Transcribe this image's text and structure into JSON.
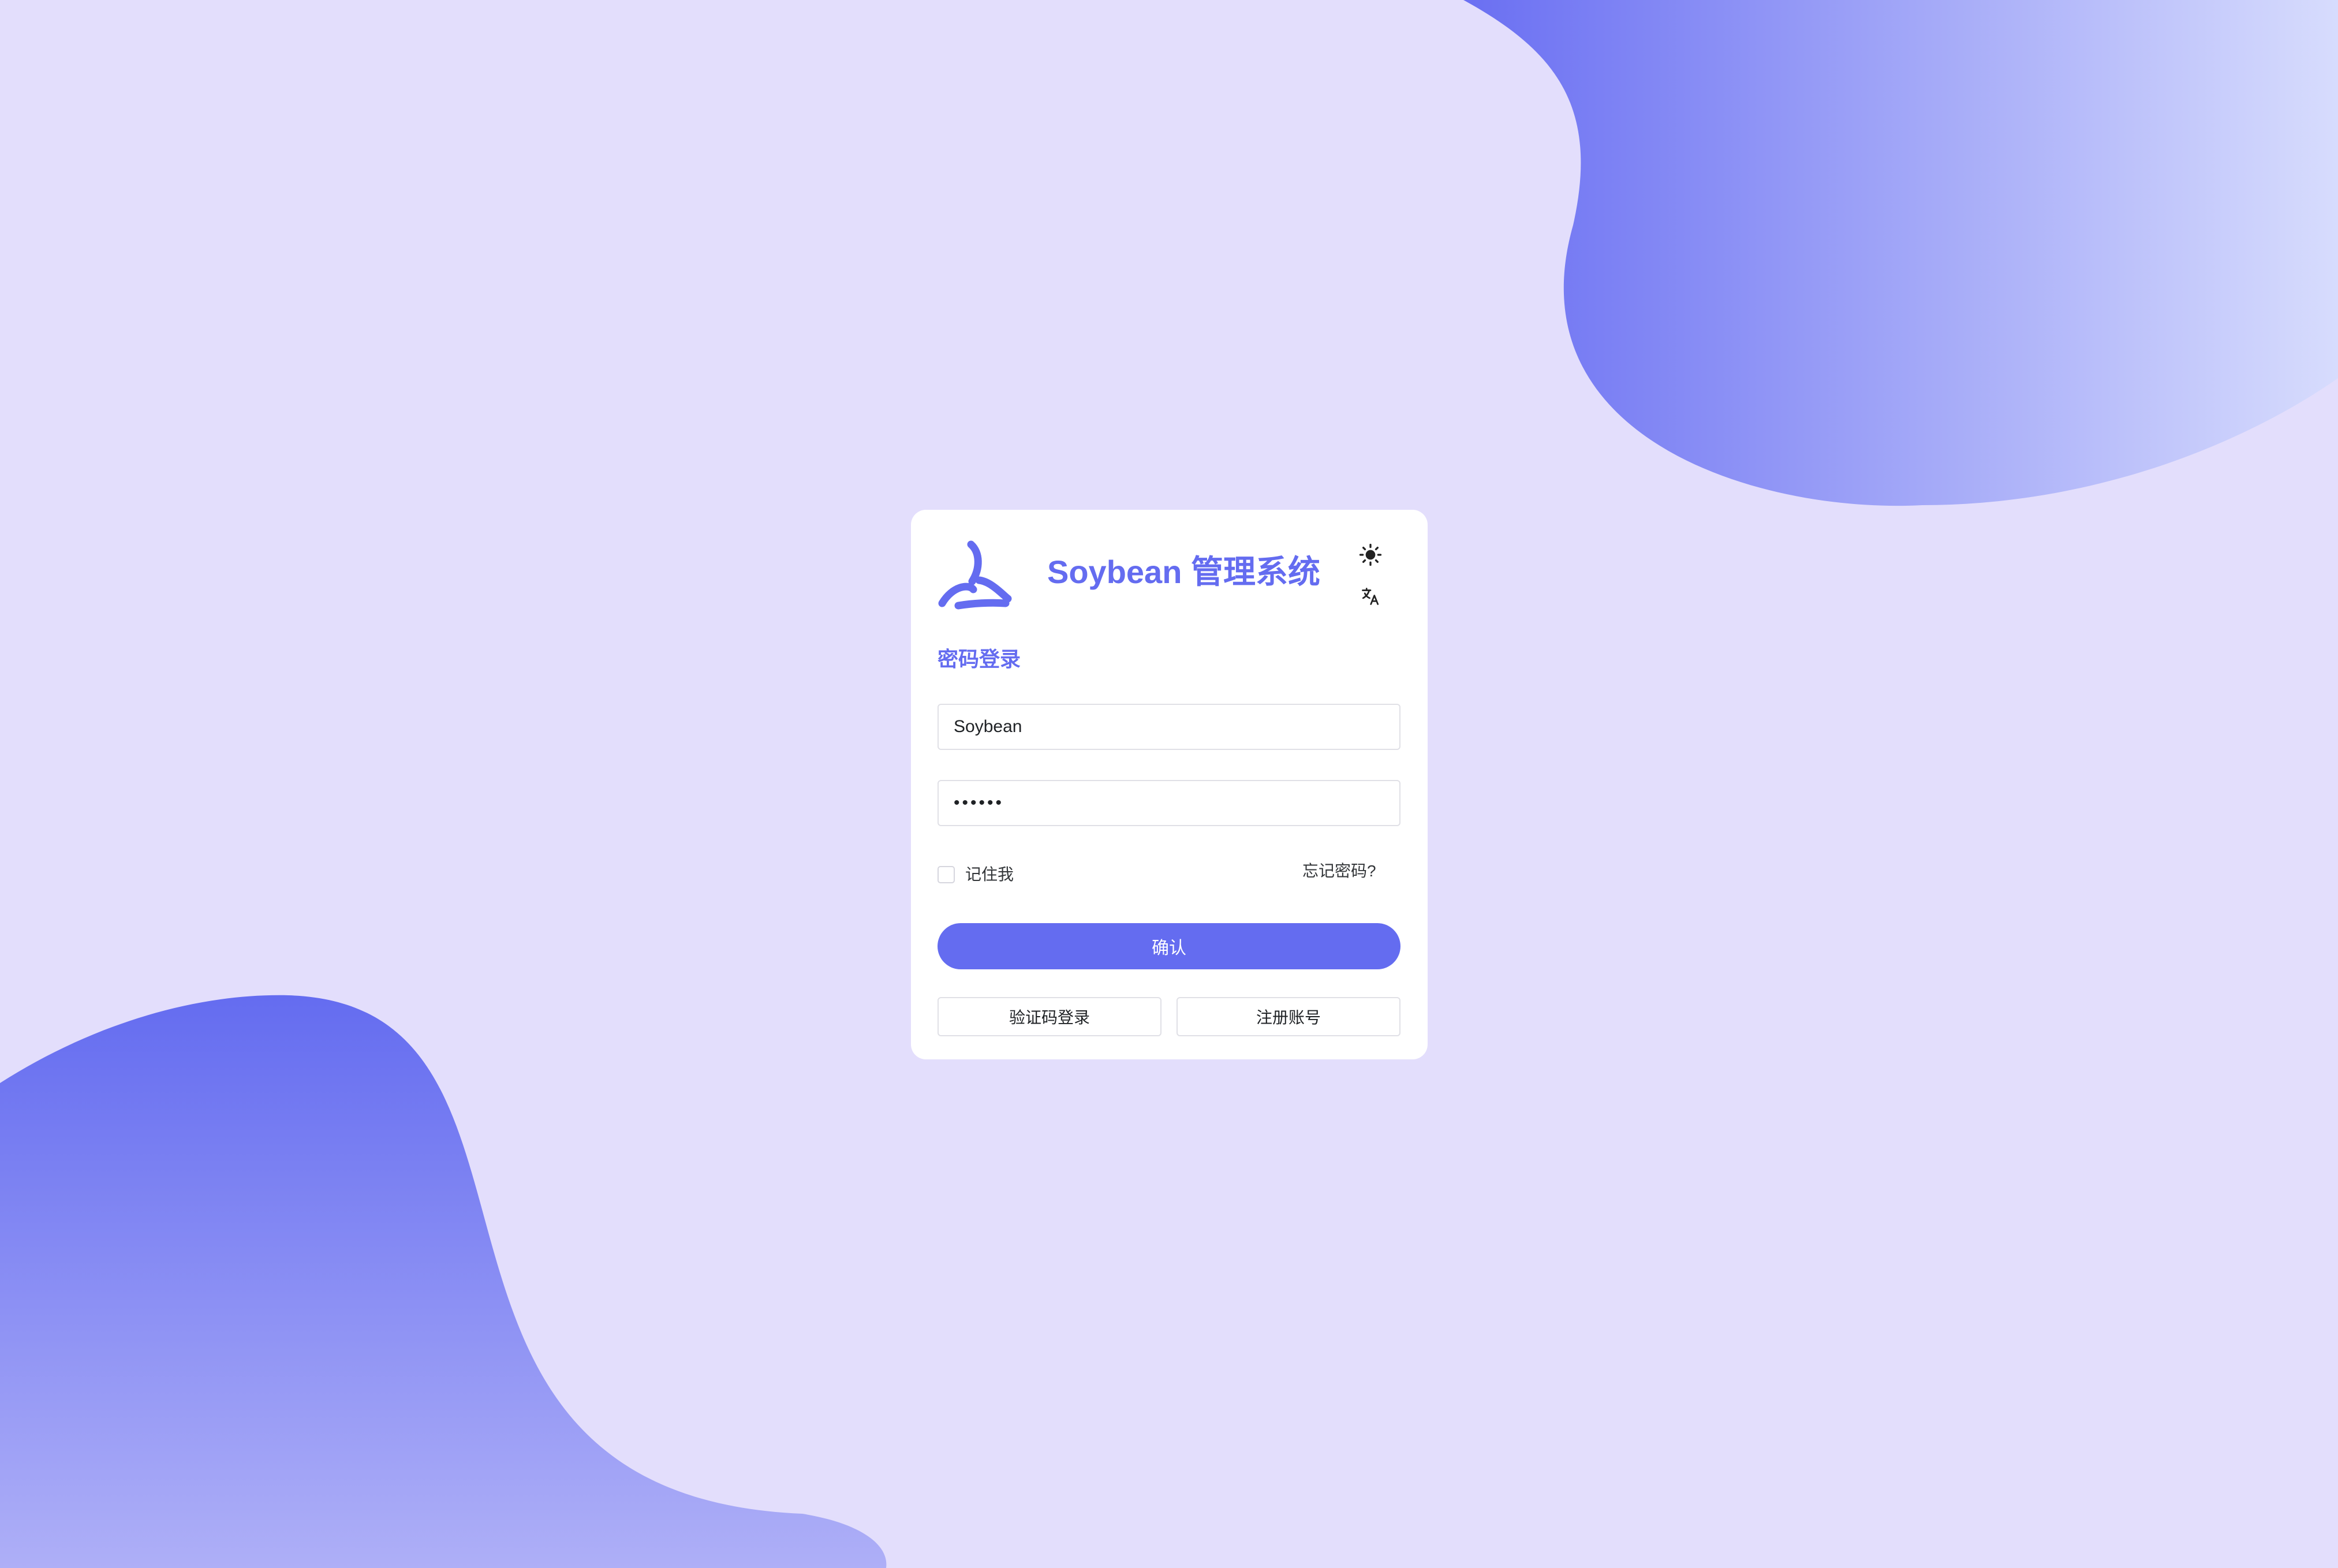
{
  "colors": {
    "primary": "#646cf0",
    "background": "#e3defc",
    "card": "#ffffff"
  },
  "header": {
    "logo_icon": "soybean-logo-icon",
    "title": "Soybean 管理系统",
    "theme_icon": "sun-icon",
    "language_icon": "translate-icon"
  },
  "login": {
    "subtitle": "密码登录",
    "username_value": "Soybean",
    "password_value": "123456",
    "remember_label": "记住我",
    "forgot_label": "忘记密码?",
    "confirm_label": "确认",
    "code_login_label": "验证码登录",
    "register_label": "注册账号"
  }
}
